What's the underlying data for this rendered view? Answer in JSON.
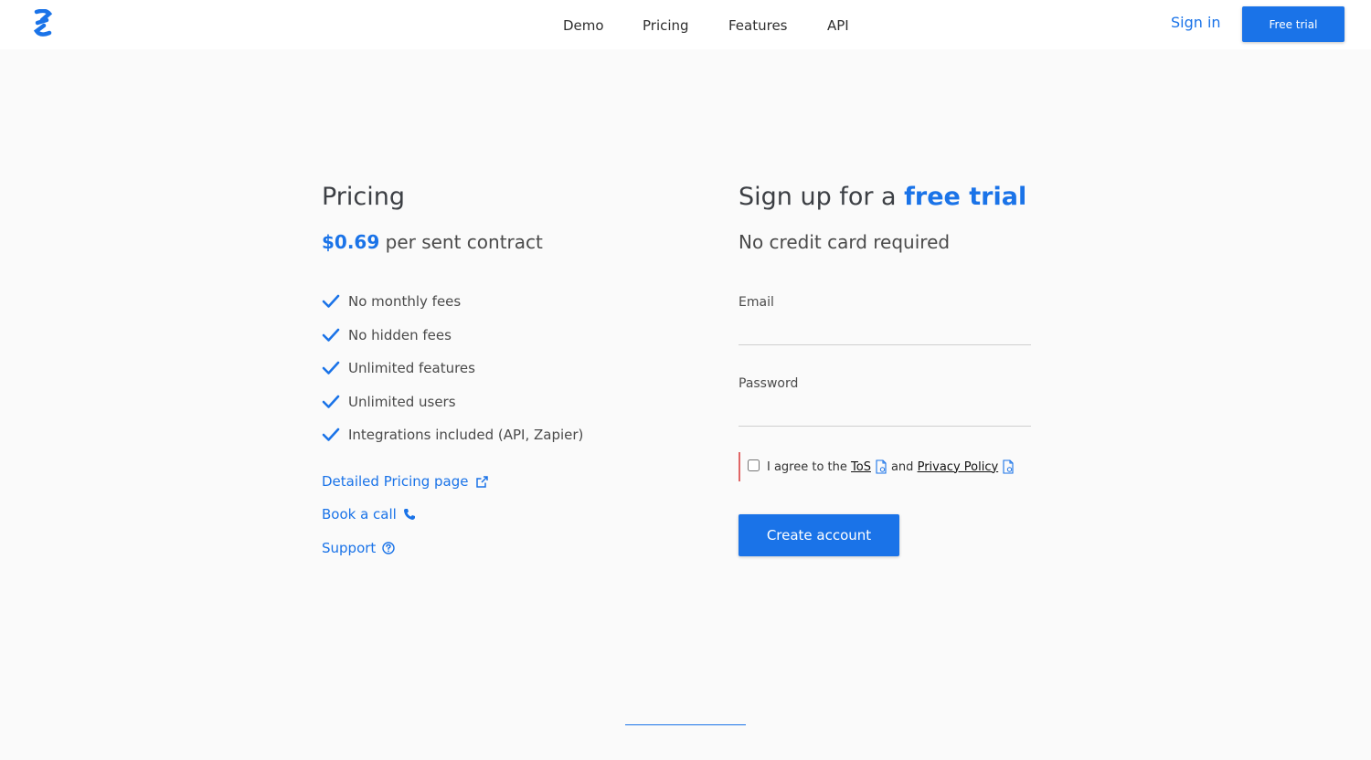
{
  "colors": {
    "accent": "#1a73e8",
    "error_bar": "#e06666"
  },
  "header": {
    "logo_icon": "s-logo-icon",
    "nav": [
      {
        "label": "Demo"
      },
      {
        "label": "Pricing"
      },
      {
        "label": "Features"
      },
      {
        "label": "API"
      }
    ],
    "signin_label": "Sign in",
    "free_trial_label": "Free trial"
  },
  "pricing": {
    "title": "Pricing",
    "price": "$0.69",
    "price_suffix": "per sent contract",
    "features": [
      "No monthly fees",
      "No hidden fees",
      "Unlimited features",
      "Unlimited users",
      "Integrations included (API, Zapier)"
    ],
    "links": [
      {
        "label": "Detailed Pricing page",
        "icon": "external-link-icon"
      },
      {
        "label": "Book a call",
        "icon": "phone-icon"
      },
      {
        "label": "Support",
        "icon": "help-circle-icon"
      }
    ]
  },
  "signup": {
    "title_prefix": "Sign up for a",
    "title_accent": "free trial",
    "subtitle": "No credit card required",
    "email_label": "Email",
    "email_value": "",
    "password_label": "Password",
    "password_value": "",
    "agree_prefix": "I agree to the",
    "tos_label": "ToS",
    "agree_and": "and",
    "privacy_label": "Privacy Policy",
    "agree_checked": false,
    "create_button_label": "Create account"
  }
}
